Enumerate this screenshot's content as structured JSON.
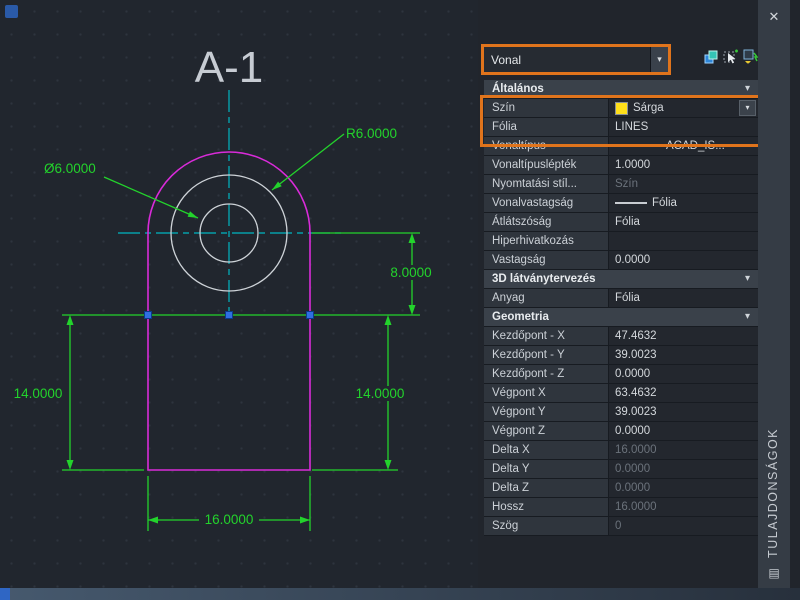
{
  "colors": {
    "canvas": "#21262e",
    "outline-magenta": "#d92bd9",
    "centerline-cyan": "#00b6c2",
    "dim-green": "#23d32c",
    "circle-white": "#ced3d8",
    "grip-blue": "#2f6fe0",
    "grip-border": "#0a3c8a",
    "highlight-orange": "#e0741c",
    "swatch-yellow": "#ffdf1a"
  },
  "icons": {
    "caret": "▾",
    "close": "✕",
    "panel_grip": "▤"
  },
  "drawing": {
    "title": "A-1",
    "dim_radius": "R6.0000",
    "dim_diameter": "Ø6.0000",
    "dim_height": "8.0000",
    "dim_left": "14.0000",
    "dim_right": "14.0000",
    "dim_width": "16.0000"
  },
  "panel": {
    "selector": {
      "value": "Vonal"
    },
    "titlebar": {
      "title": "TULAJDONSÁGOK"
    },
    "sections": [
      {
        "title": "Általános",
        "rows": [
          {
            "label": "Szín",
            "value": "Sárga"
          },
          {
            "label": "Fólia",
            "value": "LINES"
          },
          {
            "label": "Vonaltípus",
            "value": "ACAD_IS..."
          },
          {
            "label": "Vonaltípuslépték",
            "value": "1.0000"
          },
          {
            "label": "Nyomtatási stíl...",
            "value": "Szín"
          },
          {
            "label": "Vonalvastagság",
            "value": "Fólia"
          },
          {
            "label": "Átlátszóság",
            "value": "Fólia"
          },
          {
            "label": "Hiperhivatkozás",
            "value": ""
          },
          {
            "label": "Vastagság",
            "value": "0.0000"
          }
        ]
      },
      {
        "title": "3D látványtervezés",
        "rows": [
          {
            "label": "Anyag",
            "value": "Fólia"
          }
        ]
      },
      {
        "title": "Geometria",
        "rows": [
          {
            "label": "Kezdőpont - X",
            "value": "47.4632"
          },
          {
            "label": "Kezdőpont - Y",
            "value": "39.0023"
          },
          {
            "label": "Kezdőpont - Z",
            "value": "0.0000"
          },
          {
            "label": "Végpont X",
            "value": "63.4632"
          },
          {
            "label": "Végpont Y",
            "value": "39.0023"
          },
          {
            "label": "Végpont Z",
            "value": "0.0000"
          },
          {
            "label": "Delta X",
            "value": "16.0000"
          },
          {
            "label": "Delta Y",
            "value": "0.0000"
          },
          {
            "label": "Delta Z",
            "value": "0.0000"
          },
          {
            "label": "Hossz",
            "value": "16.0000"
          },
          {
            "label": "Szög",
            "value": "0"
          }
        ]
      }
    ]
  }
}
